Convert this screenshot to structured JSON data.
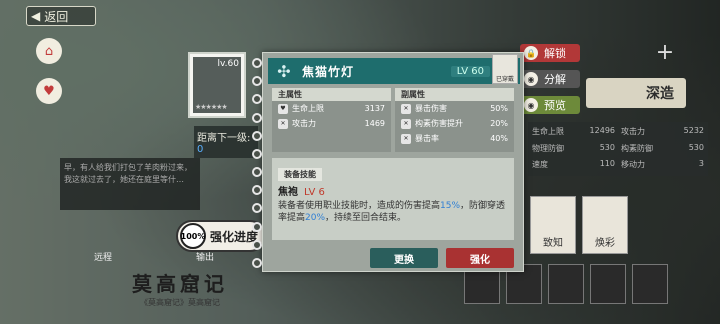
{
  "nav": {
    "back_label": "返回"
  },
  "side": {
    "distance_label": "距离下一级:",
    "distance_value": "0",
    "chat_text": "早，有人给我们打包了羊肉粉过来，我这就过去了，她还在庭里等什…",
    "progress_percent": "100%",
    "progress_label": "强化进度",
    "tab_left": "远程",
    "tab_right": "输出",
    "name_big": "莫高窟记",
    "name_small": "《莫高窟记》莫高窟记"
  },
  "equipment": {
    "name": "焦猫竹灯",
    "level": "LV 60",
    "thumb_level": "lv.60",
    "portrait_label": "已穿戴",
    "main_attr_header": "主属性",
    "sub_attr_header": "副属性",
    "main_stats": [
      {
        "label": "生命上限",
        "value": "3137"
      },
      {
        "label": "攻击力",
        "value": "1469"
      }
    ],
    "sub_stats": [
      {
        "label": "暴击伤害",
        "value": "50%"
      },
      {
        "label": "构素伤害提升",
        "value": "20%"
      },
      {
        "label": "暴击率",
        "value": "40%"
      }
    ],
    "skill_header": "装备技能",
    "skill_name": "焦袍",
    "skill_level": "LV 6",
    "skill_desc_1": "装备者使用职业技能时，造成的伤害提高",
    "skill_hl_1": "15%",
    "skill_desc_2": "，防御穿透率提高",
    "skill_hl_2": "20%",
    "skill_desc_3": "，持续至回合结束。"
  },
  "buttons": {
    "replace": "更换",
    "upgrade": "强化"
  },
  "actions": {
    "unlock": "解锁",
    "decompose": "分解",
    "preview": "预览",
    "deep_forge": "深造"
  },
  "right_panel": [
    {
      "label": "生命上限",
      "value": "12496"
    },
    {
      "label": "攻击力",
      "value": "5232"
    },
    {
      "label": "物理防御",
      "value": "530"
    },
    {
      "label": "构素防御",
      "value": "530"
    },
    {
      "label": "速度",
      "value": "110"
    },
    {
      "label": "移动力",
      "value": "3"
    }
  ],
  "right_cards": [
    "致知",
    "焕彩"
  ]
}
